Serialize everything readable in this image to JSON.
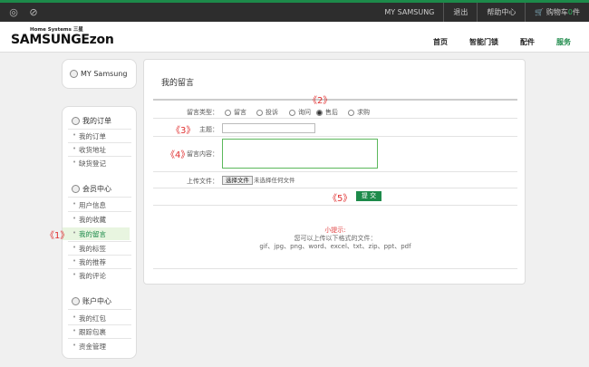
{
  "topbar": {
    "links": [
      "MY SAMSUNG",
      "退出",
      "帮助中心"
    ],
    "cart_label": "购物车",
    "cart_count": "0",
    "cart_unit": "件"
  },
  "header": {
    "logo_small": "Home Systems 三星",
    "logo": "SAMSUNGEzon",
    "nav": [
      "首页",
      "智能门锁",
      "配件",
      "服务"
    ]
  },
  "sidebar": {
    "profile": "MY Samsung",
    "groups": [
      {
        "title": "我的订单",
        "items": [
          "我的订单",
          "收货地址",
          "缺货登记"
        ]
      },
      {
        "title": "会员中心",
        "items": [
          "用户信息",
          "我的收藏",
          "我的留言",
          "我的标签",
          "我的推荐",
          "我的评论"
        ]
      },
      {
        "title": "账户中心",
        "items": [
          "我的红包",
          "跟踪包裹",
          "资金管理"
        ]
      }
    ]
  },
  "main": {
    "title": "我的留言",
    "type_label": "留言类型：",
    "types": [
      "留言",
      "投诉",
      "询问",
      "售后",
      "求购"
    ],
    "selected_type": "售后",
    "subject_label": "主题：",
    "content_label": "留言内容：",
    "file_label": "上传文件：",
    "file_button": "选择文件",
    "file_status": "未选择任何文件",
    "submit": "提 交",
    "tip_title": "小提示:",
    "tip_line1": "您可以上传以下格式的文件：",
    "tip_line2": "gif、jpg、png、word、excel、txt、zip、ppt、pdf"
  },
  "annotations": [
    "《1》",
    "《2》",
    "《3》",
    "《4》",
    "《5》"
  ]
}
